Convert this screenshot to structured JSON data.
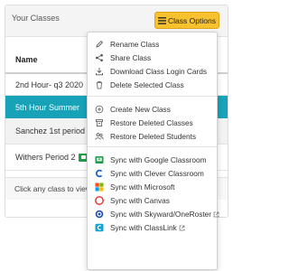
{
  "card": {
    "title": "Your Classes",
    "options_button": "Class Options",
    "column_header": "Name",
    "rows": [
      {
        "label": "2nd Hour- q3 2020",
        "selected": false
      },
      {
        "label": "5th Hour Summer",
        "selected": true
      },
      {
        "label": "Sanchez 1st period",
        "badge": "google-classroom-icon"
      },
      {
        "label": "Withers Period 2",
        "badge": "google-classroom-icon"
      }
    ],
    "footer": "Click any class to view a"
  },
  "menu": {
    "group1": [
      {
        "label": "Rename Class",
        "icon": "pencil-icon"
      },
      {
        "label": "Share Class",
        "icon": "share-icon"
      },
      {
        "label": "Download Class Login Cards",
        "icon": "download-icon"
      },
      {
        "label": "Delete Selected Class",
        "icon": "trash-icon"
      }
    ],
    "group2": [
      {
        "label": "Create New Class",
        "icon": "plus-circle-icon"
      },
      {
        "label": "Restore Deleted Classes",
        "icon": "restore-icon"
      },
      {
        "label": "Restore Deleted Students",
        "icon": "users-icon"
      }
    ],
    "group3": [
      {
        "label": "Sync with Google Classroom",
        "icon": "google-classroom-icon"
      },
      {
        "label": "Sync with Clever Classroom",
        "icon": "clever-icon"
      },
      {
        "label": "Sync with Microsoft",
        "icon": "microsoft-icon"
      },
      {
        "label": "Sync with Canvas",
        "icon": "canvas-icon"
      },
      {
        "label": "Sync with Skyward/OneRoster",
        "icon": "skyward-icon",
        "external": true
      },
      {
        "label": "Sync with ClassLink",
        "icon": "classlink-icon",
        "external": true
      }
    ]
  },
  "colors": {
    "accent_button": "#f8c22e",
    "selected_row": "#17a2b8",
    "google_classroom": "#1f9d4b"
  }
}
